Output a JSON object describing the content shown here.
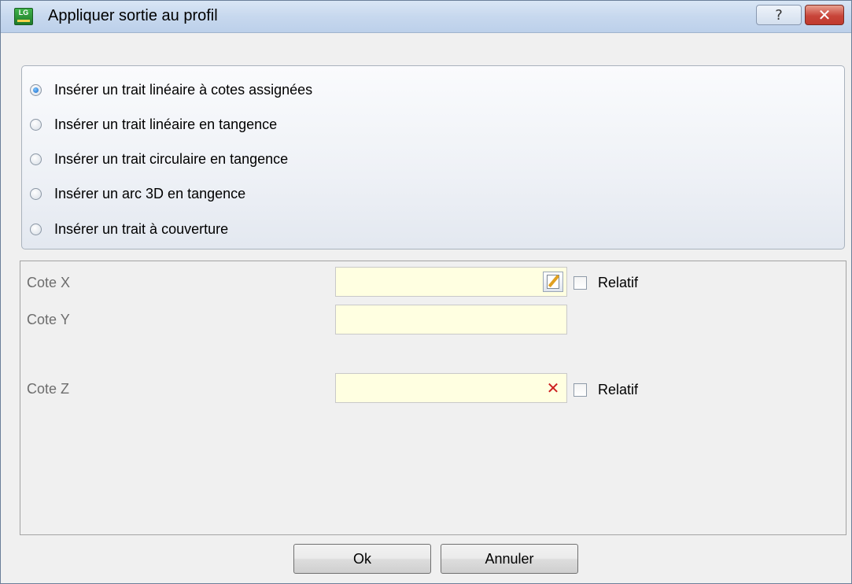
{
  "window": {
    "title": "Appliquer sortie au profil",
    "help_label": "?",
    "close_label": "✕"
  },
  "options": {
    "selected_index": 0,
    "items": [
      {
        "label": "Insérer un trait linéaire à cotes assignées",
        "checked": true
      },
      {
        "label": "Insérer un trait linéaire en tangence",
        "checked": false
      },
      {
        "label": "Insérer un trait circulaire en tangence",
        "checked": false
      },
      {
        "label": "Insérer un arc 3D en tangence",
        "checked": false
      },
      {
        "label": "Insérer un trait à couverture",
        "checked": false
      }
    ]
  },
  "fields": {
    "cote_x": {
      "label": "Cote X",
      "value": "",
      "icon": "edit-icon",
      "relative_label": "Relatif",
      "relative_checked": false
    },
    "cote_y": {
      "label": "Cote Y",
      "value": ""
    },
    "cote_z": {
      "label": "Cote Z",
      "value": "",
      "icon": "clear-icon",
      "relative_label": "Relatif",
      "relative_checked": false
    }
  },
  "buttons": {
    "ok_label": "Ok",
    "cancel_label": "Annuler"
  },
  "colors": {
    "input_background": "#ffffe1",
    "title_bar": "#c7d8ee",
    "close_button": "#c8453a"
  }
}
